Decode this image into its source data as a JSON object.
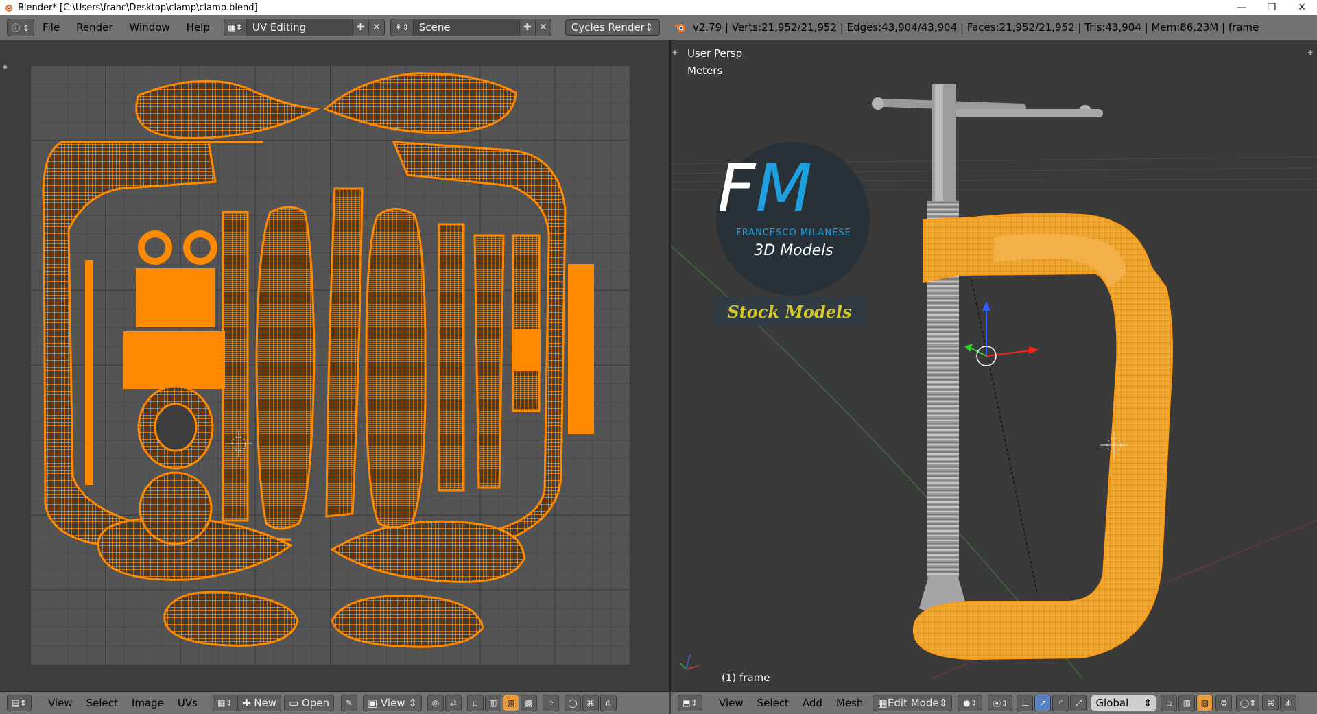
{
  "window": {
    "title": "Blender* [C:\\Users\\franc\\Desktop\\clamp\\clamp.blend]",
    "minimize": "—",
    "maximize": "❐",
    "close": "✕"
  },
  "info_header": {
    "menus": [
      "File",
      "Render",
      "Window",
      "Help"
    ],
    "screen_layout": "UV Editing",
    "scene": "Scene",
    "render_engine": "Cycles Render",
    "stats": "v2.79 | Verts:21,952/21,952 | Edges:43,904/43,904 | Faces:21,952/21,952 | Tris:43,904 | Mem:86.23M | frame"
  },
  "view3d": {
    "view_name": "User Persp",
    "units": "Meters",
    "object_label": "(1) frame",
    "logo": {
      "initials_f": "F",
      "initials_m": "M",
      "author": "FRANCESCO MILANESE",
      "subtitle": "3D Models",
      "banner": "Stock Models"
    }
  },
  "uv_footer": {
    "menus": [
      "View",
      "Select",
      "Image",
      "UVs"
    ],
    "new_label": "New",
    "open_label": "Open",
    "view_label": "View"
  },
  "view3d_footer": {
    "menus": [
      "View",
      "Select",
      "Add",
      "Mesh"
    ],
    "mode": "Edit Mode",
    "orientation": "Global"
  },
  "colors": {
    "uv_orange": "#ff8a00",
    "header_grey": "#727272",
    "logo_blue": "#1ea0e0",
    "banner_yellow": "#d6c82a"
  }
}
